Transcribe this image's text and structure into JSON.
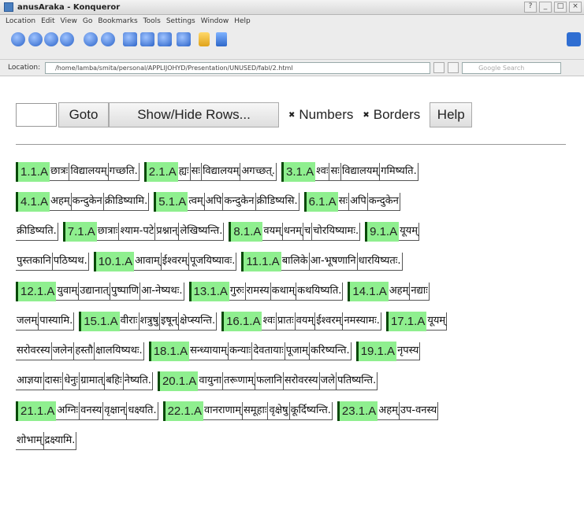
{
  "window": {
    "title": "anusAraka - Konqueror",
    "buttons": [
      "?",
      "_",
      "□",
      "×"
    ]
  },
  "menubar": [
    "Location",
    "Edit",
    "View",
    "Go",
    "Bookmarks",
    "Tools",
    "Settings",
    "Window",
    "Help"
  ],
  "locationbar": {
    "label": "Location:",
    "url": "/home/lamba/smita/personal/APPLIJOHYD/Presentation/UNUSED/fabl/2.html",
    "search_placeholder": "Google Search"
  },
  "controls": {
    "goto_value": "",
    "goto_label": "Goto",
    "showhide_label": "Show/Hide Rows...",
    "numbers_label": "Numbers",
    "borders_label": "Borders",
    "help_label": "Help",
    "check_glyph": "✖"
  },
  "lines": [
    [
      {
        "id": "1.1.A",
        "words": [
          "छात्रः",
          "विद्यालयम्",
          "गच्छति."
        ]
      },
      {
        "id": "2.1.A",
        "words": [
          "ह्यः",
          "सः",
          "विद्यालयम्",
          "अगच्छत्."
        ]
      },
      {
        "id": "3.1.A",
        "words": [
          "श्वः",
          "सः",
          "विद्यालयम्",
          "गमिष्यति."
        ]
      }
    ],
    [
      {
        "id": "4.1.A",
        "words": [
          "अहम्",
          "कन्दुकेन",
          "क्रीडिष्यामि."
        ]
      },
      {
        "id": "5.1.A",
        "words": [
          "त्वम्",
          "अपि",
          "कन्दुकेन",
          "क्रीडिष्यसि."
        ]
      },
      {
        "id": "6.1.A",
        "words": [
          "सः",
          "अपि",
          "कन्दुकेन"
        ]
      }
    ],
    [
      {
        "id": "",
        "words": [
          "क्रीडिष्यति."
        ]
      },
      {
        "id": "7.1.A",
        "words": [
          "छात्राः",
          "श्याम-पटे",
          "प्रश्नान्",
          "लेखिष्यन्ति."
        ]
      },
      {
        "id": "8.1.A",
        "words": [
          "वयम्",
          "धनम्",
          "च",
          "चोरयिष्यामः."
        ]
      },
      {
        "id": "9.1.A",
        "words": [
          "यूयम्"
        ]
      }
    ],
    [
      {
        "id": "",
        "words": [
          "पुस्तकानि",
          "पठिष्यथ."
        ]
      },
      {
        "id": "10.1.A",
        "words": [
          "आवाम्",
          "ईश्वरम्",
          "पूजयिष्यावः."
        ]
      },
      {
        "id": "11.1.A",
        "words": [
          "बालिके",
          "आ-भूषणानि",
          "धारयिष्यतः."
        ]
      }
    ],
    [
      {
        "id": "12.1.A",
        "words": [
          "युवाम्",
          "उद्यानात्",
          "पुष्पाणि",
          "आ-नेष्यथः."
        ]
      },
      {
        "id": "13.1.A",
        "words": [
          "गुरुः",
          "रामस्य",
          "कथाम्",
          "कथयिष्यति."
        ]
      },
      {
        "id": "14.1.A",
        "words": [
          "अहम्",
          "नद्याः"
        ]
      }
    ],
    [
      {
        "id": "",
        "words": [
          "जलम्",
          "पास्यामि."
        ]
      },
      {
        "id": "15.1.A",
        "words": [
          "वीराः",
          "शत्रुषु",
          "इषून्",
          "क्षेप्स्यन्ति."
        ]
      },
      {
        "id": "16.1.A",
        "words": [
          "श्वः",
          "प्रातः",
          "वयम्",
          "ईश्वरम्",
          "नमस्यामः."
        ]
      },
      {
        "id": "17.1.A",
        "words": [
          "यूयम्"
        ]
      }
    ],
    [
      {
        "id": "",
        "words": [
          "सरोवरस्य",
          "जलेन",
          "हस्तौ",
          "क्षालयिष्यथः."
        ]
      },
      {
        "id": "18.1.A",
        "words": [
          "सन्ध्यायाम्",
          "कन्याः",
          "देवतायाः",
          "पूजाम्",
          "करिष्यन्ति."
        ]
      },
      {
        "id": "19.1.A",
        "words": [
          "नृपस्य"
        ]
      }
    ],
    [
      {
        "id": "",
        "words": [
          "आज्ञया",
          "दासः",
          "धेनुः",
          "ग्रामात्",
          "बहिः",
          "नेष्यति."
        ]
      },
      {
        "id": "20.1.A",
        "words": [
          "वायुना",
          "तरूणाम्",
          "फलानि",
          "सरोवरस्य",
          "जले",
          "पतिष्यन्ति."
        ]
      }
    ],
    [
      {
        "id": "21.1.A",
        "words": [
          "अग्निः",
          "वनस्य",
          "वृक्षान्",
          "धक्ष्यति."
        ]
      },
      {
        "id": "22.1.A",
        "words": [
          "वानराणाम्",
          "समूहाः",
          "वृक्षेषु",
          "कूर्दिष्यन्ति."
        ]
      },
      {
        "id": "23.1.A",
        "words": [
          "अहम्",
          "उप-वनस्य"
        ]
      }
    ],
    [
      {
        "id": "",
        "words": [
          "शोभाम्",
          "द्रक्ष्यामि."
        ]
      }
    ]
  ]
}
